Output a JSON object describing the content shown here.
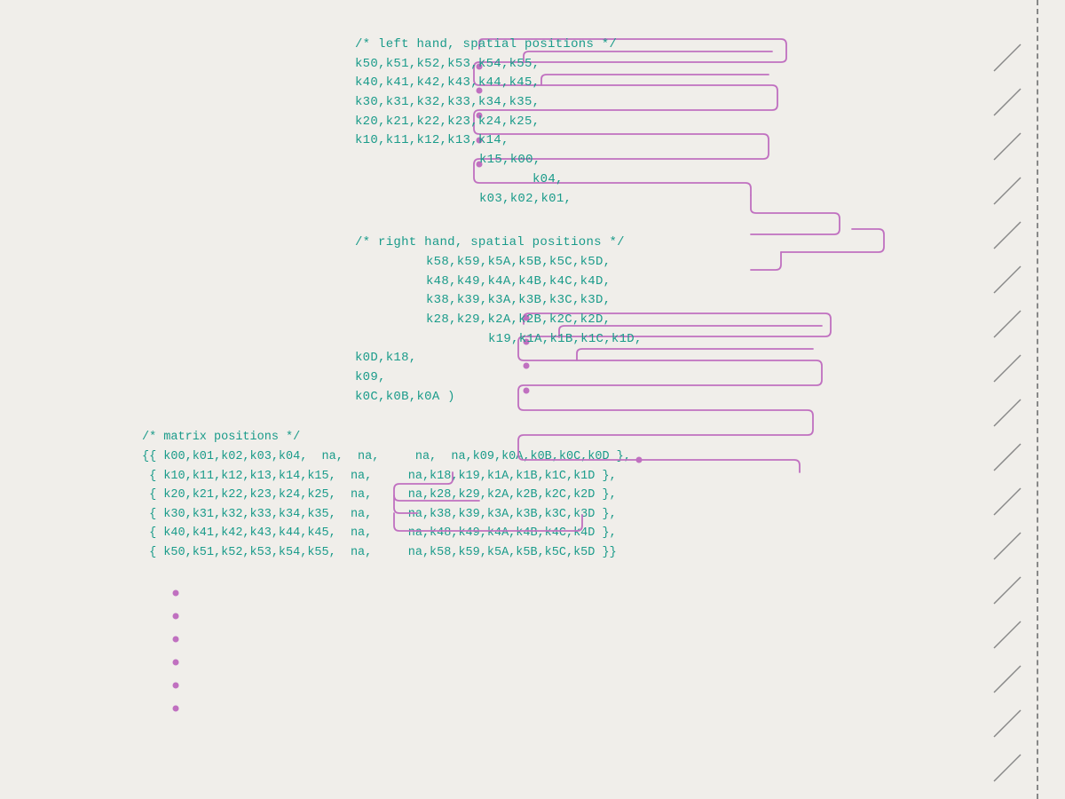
{
  "page": {
    "background": "#f0eeea",
    "sections": {
      "left_hand": {
        "comment": "/* left hand, spatial positions */",
        "lines": [
          "k50,k51,k52,k53,k54,k55,",
          "k40,k41,k42,k43,k44,k45,",
          "k30,k31,k32,k33,k34,k35,",
          "k20,k21,k22,k23,k24,k25,",
          "k10,k11,k12,k13,k14,",
          "                    k15,k00,",
          "                         k04,",
          "                    k03,k02,k01,"
        ]
      },
      "right_hand": {
        "comment": "/* right hand, spatial positions */",
        "lines": [
          "     k58,k59,k5A,k5B,k5C,k5D,",
          "     k48,k49,k4A,k4B,k4C,k4D,",
          "     k38,k39,k3A,k3B,k3C,k3D,",
          "     k28,k29,k2A,k2B,k2C,k2D,",
          "          k19,k1A,k1B,k1C,k1D,",
          "k0D,k18,",
          "k09,",
          "k0C,k0B,k0A )"
        ]
      },
      "matrix": {
        "comment": "/* matrix positions */",
        "lines": [
          "{{ k00,k01,k02,k03,k04,  na,  na,     na,  na,k09,k0A,k0B,k0C,k0D },",
          " { k10,k11,k12,k13,k14,k15,  na,     na,k18,k19,k1A,k1B,k1C,k1D },",
          " { k20,k21,k22,k23,k24,k25,  na,     na,k28,k29,k2A,k2B,k2C,k2D },",
          " { k30,k31,k32,k33,k34,k35,  na,     na,k38,k39,k3A,k3B,k3C,k3D },",
          " { k40,k41,k42,k43,k44,k45,  na,     na,k48,k49,k4A,k4B,k4C,k4D },",
          " { k50,k51,k52,k53,k54,k55,  na,     na,k58,k59,k5A,k5B,k5C,k5D }}"
        ]
      }
    }
  }
}
